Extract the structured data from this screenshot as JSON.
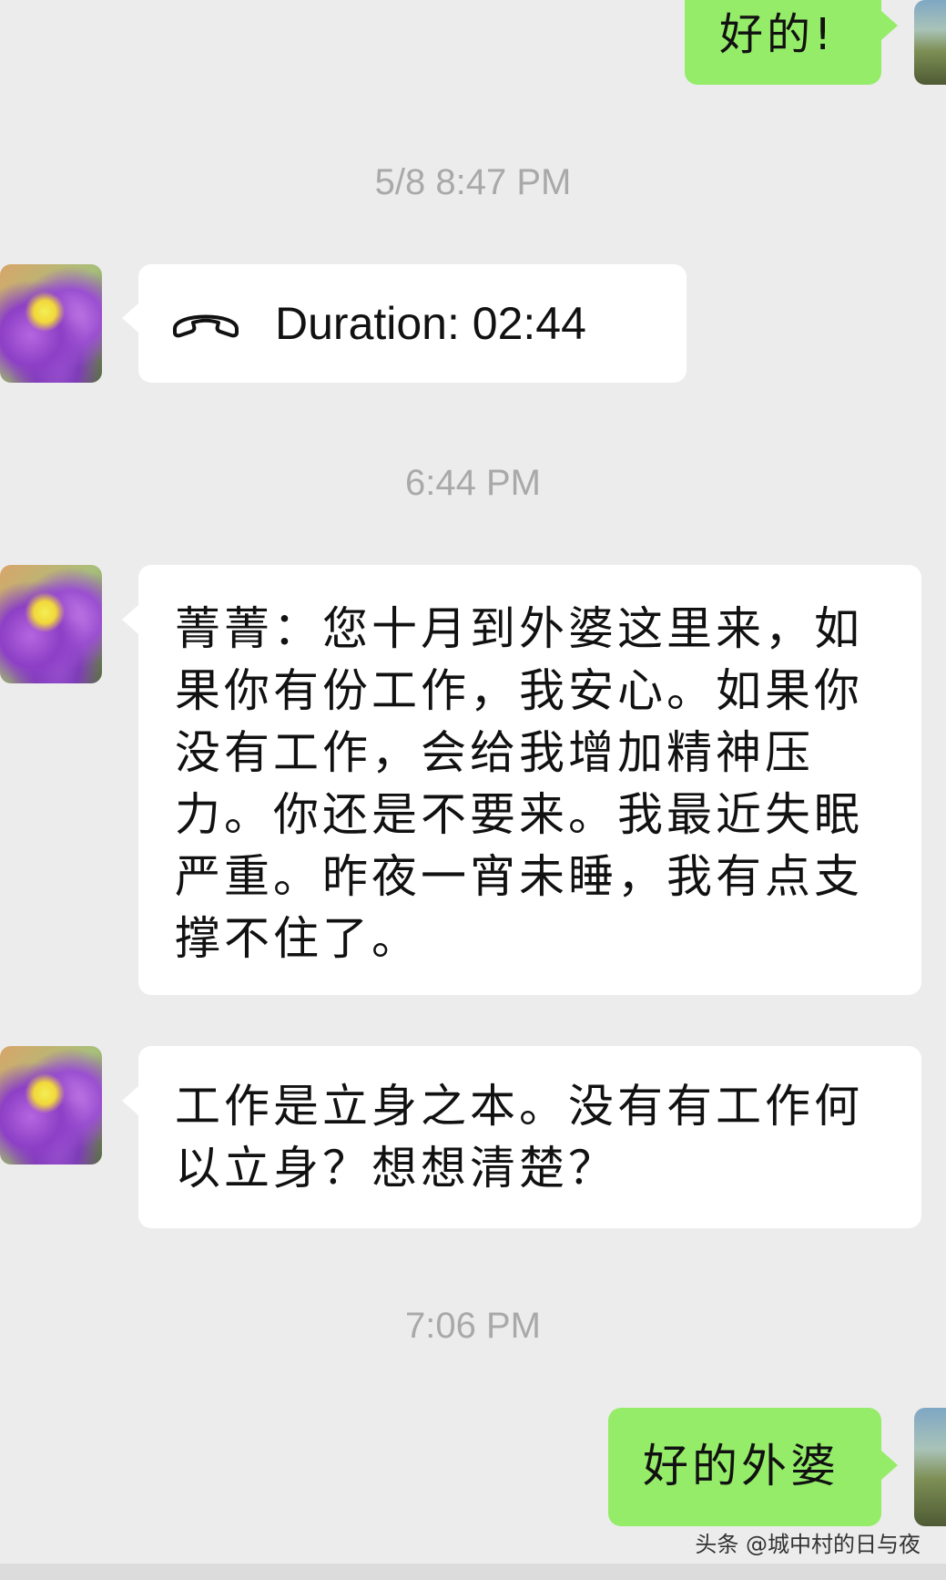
{
  "messages": {
    "m1_text": "好的!",
    "ts1": "5/8 8:47 PM",
    "call_label": "Duration: 02:44",
    "ts2": "6:44 PM",
    "m2_text": "菁菁：您十月到外婆这里来，如果你有份工作，我安心。如果你没有工作，会给我增加精神压力。你还是不要来。我最近失眠严重。昨夜一宵未睡，我有点支撑不住了。",
    "m3_text": "工作是立身之本。没有有工作何以立身？想想清楚？",
    "ts3": "7:06 PM",
    "m4_text": "好的外婆"
  },
  "icons": {
    "call": "phone-handset-icon"
  },
  "watermark": "头条 @城中村的日与夜",
  "colors": {
    "background": "#ececec",
    "outgoing_bubble": "#95ec69",
    "incoming_bubble": "#ffffff",
    "timestamp": "#a9a9a9"
  }
}
